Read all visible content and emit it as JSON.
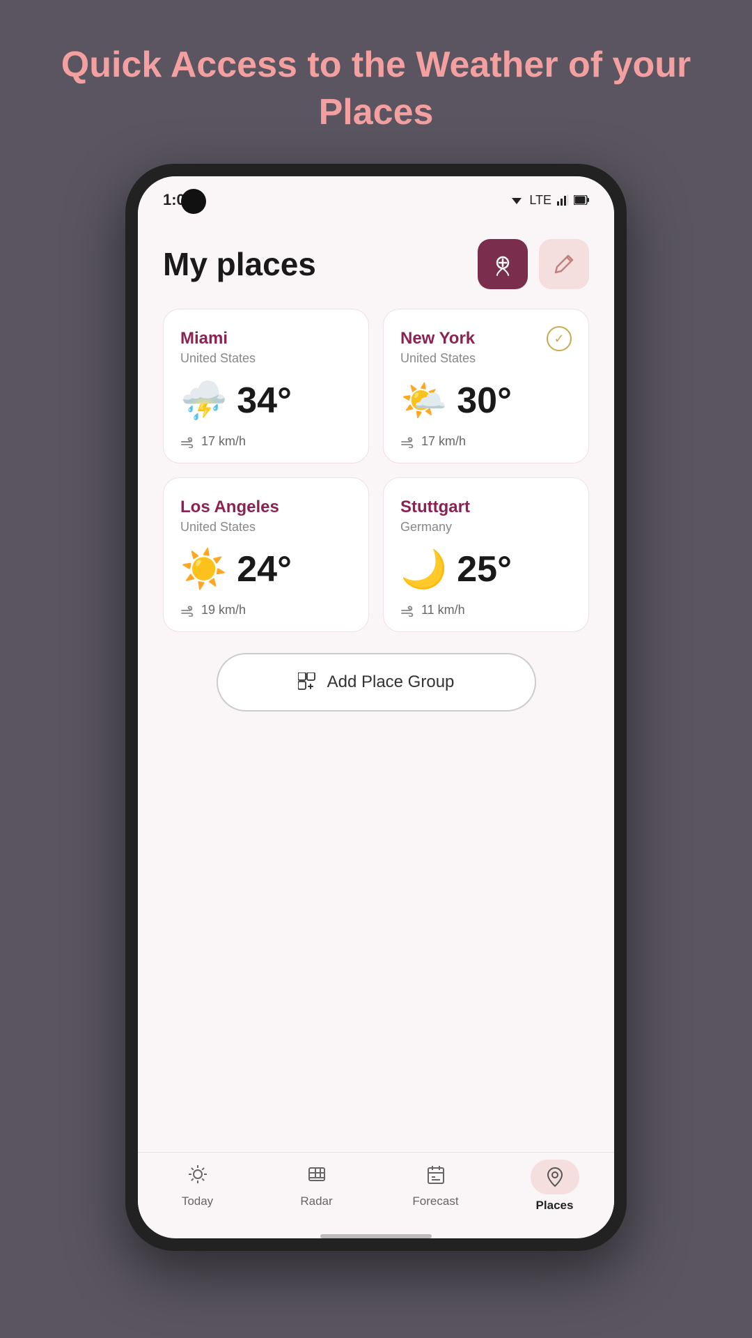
{
  "header": {
    "title": "Quick Access to the Weather of your Places"
  },
  "statusBar": {
    "time": "1:00",
    "signal": "LTE"
  },
  "screen": {
    "title": "My places",
    "addLocationBtn": "add-location",
    "editBtn": "edit"
  },
  "weatherCards": [
    {
      "city": "Miami",
      "country": "United States",
      "temp": "34°",
      "wind": "17 km/h",
      "icon": "⛈️",
      "checked": false
    },
    {
      "city": "New York",
      "country": "United States",
      "temp": "30°",
      "wind": "17 km/h",
      "icon": "🌤️",
      "checked": true
    },
    {
      "city": "Los Angeles",
      "country": "United States",
      "temp": "24°",
      "wind": "19 km/h",
      "icon": "☀️",
      "checked": false
    },
    {
      "city": "Stuttgart",
      "country": "Germany",
      "temp": "25°",
      "wind": "11 km/h",
      "icon": "🌙",
      "checked": false
    }
  ],
  "addGroupBtn": "Add Place Group",
  "bottomNav": [
    {
      "label": "Today",
      "icon": "today",
      "active": false
    },
    {
      "label": "Radar",
      "icon": "radar",
      "active": false
    },
    {
      "label": "Forecast",
      "icon": "forecast",
      "active": false
    },
    {
      "label": "Places",
      "icon": "places",
      "active": true
    }
  ]
}
